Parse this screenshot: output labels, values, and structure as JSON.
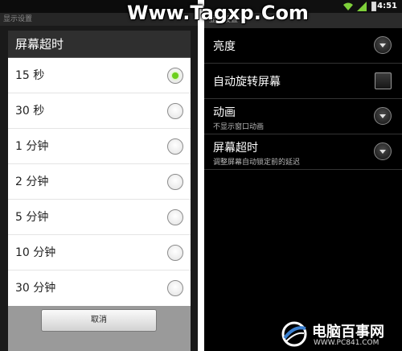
{
  "watermark": {
    "top_text": "Www.Tagxp.Com"
  },
  "left_screen": {
    "background_title": "显示设置",
    "dialog": {
      "title": "屏幕超时",
      "options": [
        {
          "label": "15 秒",
          "selected": true
        },
        {
          "label": "30 秒",
          "selected": false
        },
        {
          "label": "1 分钟",
          "selected": false
        },
        {
          "label": "2 分钟",
          "selected": false
        },
        {
          "label": "5 分钟",
          "selected": false
        },
        {
          "label": "10 分钟",
          "selected": false
        },
        {
          "label": "30 分钟",
          "selected": false
        }
      ],
      "cancel_label": "取消"
    }
  },
  "right_screen": {
    "status_bar": {
      "time": "4:51",
      "icons": [
        "wifi-icon",
        "signal-icon",
        "battery-icon"
      ]
    },
    "title": "显示设置",
    "settings": [
      {
        "title": "亮度",
        "subtitle": "",
        "control": "dropdown"
      },
      {
        "title": "自动旋转屏幕",
        "subtitle": "",
        "control": "checkbox",
        "checked": false
      },
      {
        "title": "动画",
        "subtitle": "不显示窗口动画",
        "control": "dropdown"
      },
      {
        "title": "屏幕超时",
        "subtitle": "调整屏幕自动锁定前的延迟",
        "control": "dropdown"
      }
    ]
  },
  "logo": {
    "text_cn": "电脑百事网",
    "url": "WWW.PC841.COM"
  },
  "colors": {
    "radio_selected": "#6ccf1c",
    "dialog_header": "#2f2f2f",
    "right_background": "#000000"
  }
}
